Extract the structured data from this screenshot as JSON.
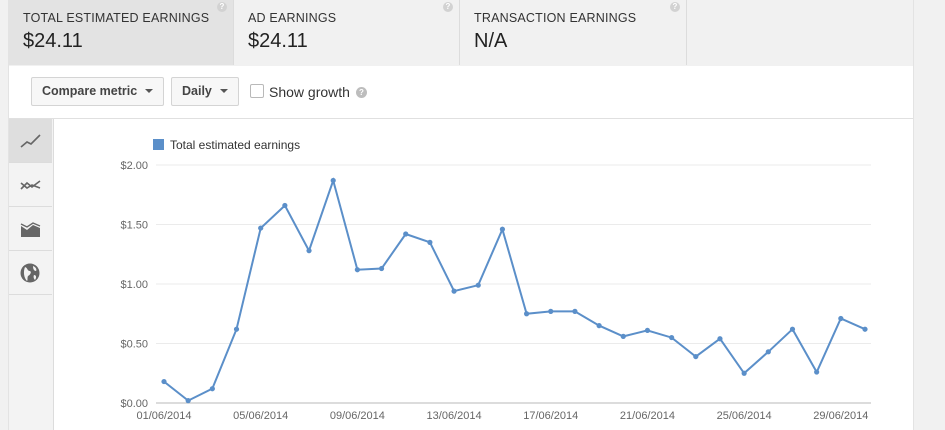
{
  "tabs": [
    {
      "label": "TOTAL ESTIMATED EARNINGS",
      "value": "$24.11",
      "help": "?"
    },
    {
      "label": "AD EARNINGS",
      "value": "$24.11",
      "help": "?"
    },
    {
      "label": "TRANSACTION EARNINGS",
      "value": "N/A",
      "help": "?"
    }
  ],
  "toolbar": {
    "compare_label": "Compare metric",
    "period_label": "Daily",
    "show_growth_label": "Show growth",
    "show_growth_checked": false,
    "help": "?"
  },
  "side_buttons": [
    "line-chart-icon",
    "compare-lines-icon",
    "area-chart-icon",
    "globe-icon"
  ],
  "colors": {
    "series": "#5b8fc9",
    "grid": "#ebebeb",
    "axis": "#666666"
  },
  "chart_data": {
    "type": "line",
    "title": "",
    "xlabel": "",
    "ylabel": "",
    "ylim": [
      0,
      2
    ],
    "yticks": [
      "$0.00",
      "$0.50",
      "$1.00",
      "$1.50",
      "$2.00"
    ],
    "xticks": [
      "01/06/2014",
      "05/06/2014",
      "09/06/2014",
      "13/06/2014",
      "17/06/2014",
      "21/06/2014",
      "25/06/2014",
      "29/06/2014"
    ],
    "legend": "top-left",
    "grid": true,
    "series": [
      {
        "name": "Total estimated earnings",
        "color": "#5b8fc9",
        "x": [
          "01/06/2014",
          "02/06/2014",
          "03/06/2014",
          "04/06/2014",
          "05/06/2014",
          "06/06/2014",
          "07/06/2014",
          "08/06/2014",
          "09/06/2014",
          "10/06/2014",
          "11/06/2014",
          "12/06/2014",
          "13/06/2014",
          "14/06/2014",
          "15/06/2014",
          "16/06/2014",
          "17/06/2014",
          "18/06/2014",
          "19/06/2014",
          "20/06/2014",
          "21/06/2014",
          "22/06/2014",
          "23/06/2014",
          "24/06/2014",
          "25/06/2014",
          "26/06/2014",
          "27/06/2014",
          "28/06/2014",
          "29/06/2014",
          "30/06/2014"
        ],
        "values": [
          0.18,
          0.02,
          0.12,
          0.62,
          1.47,
          1.66,
          1.28,
          1.87,
          1.12,
          1.13,
          1.42,
          1.35,
          0.94,
          0.99,
          1.46,
          0.75,
          0.77,
          0.77,
          0.65,
          0.56,
          0.61,
          0.55,
          0.39,
          0.54,
          0.25,
          0.43,
          0.62,
          0.26,
          0.71,
          0.62
        ]
      }
    ]
  }
}
